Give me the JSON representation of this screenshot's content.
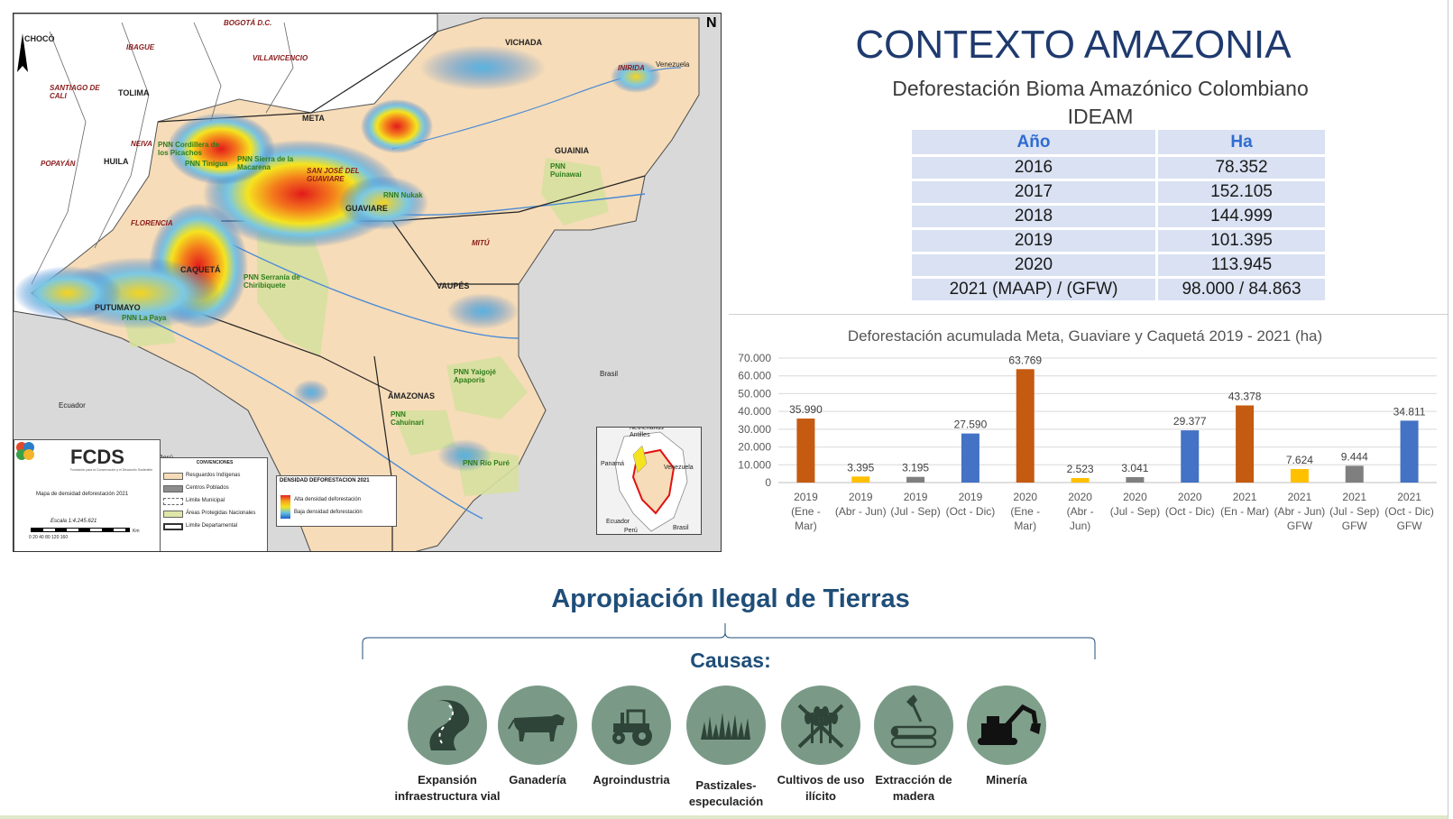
{
  "map": {
    "departments": [
      "META",
      "GUAVIARE",
      "CAQUETÁ",
      "PUTUMAYO",
      "VAUPÉS",
      "AMAZONAS",
      "GUAINIA",
      "VICHADA",
      "INIRIDA",
      "MITÚ",
      "TOLIMA",
      "HUILA",
      "NEIVA",
      "CHOCÓ",
      "IBAGUE",
      "POPAYÁN",
      "SANTIAGO DE CALI",
      "BOGOTÁ D.C.",
      "VILLAVICENCIO",
      "SAN JOSÉ DEL GUAVIARE",
      "FLORENCIA"
    ],
    "protected_areas": [
      "PNN Cordillera de los Picachos",
      "PNN Tinigua",
      "PNN Sierra de la Macarena",
      "RNN Nukak",
      "PNN Puinawai",
      "PNN Serranía de Chiribiquete",
      "PNN La Paya",
      "PNN Yaigojé Apaporis",
      "PNN Cahuinarí",
      "PNN Río Puré"
    ],
    "countries": [
      "Ecuador",
      "Perú",
      "Brasil",
      "Venezuela"
    ],
    "north_label": "N",
    "logo_text": "FCDS",
    "logo_subtitle": "Fundación para la Conservación y el Desarrollo Sostenible",
    "map_title": "Mapa de densidad deforestación 2021",
    "scale_text": "Escala 1:4.245.621",
    "scale_ticks": "0   20   40        80        120       160",
    "scale_unit": "Km",
    "conventions_title": "CONVENCIONES",
    "conventions": [
      {
        "label": "Resguardos Indígenas",
        "color": "#f6dcb8"
      },
      {
        "label": "Centros Poblados",
        "color": "#8c8c8c"
      },
      {
        "label": "Limite Municipal",
        "color": "#ffffff"
      },
      {
        "label": "Áreas Protegidas Nacionales",
        "color": "#dfe6a8"
      },
      {
        "label": "Limite Departamental",
        "color": "#ffffff"
      }
    ],
    "density_title": "DENSIDAD DEFORESTACION 2021",
    "density_high": "Alta densidad deforestación",
    "density_low": "Baja densidad deforestación",
    "inset_labels": [
      "Netherlands Antilles",
      "Panamá",
      "Venezuela",
      "Ecuador",
      "Perú",
      "Brasil"
    ]
  },
  "header": {
    "title": "CONTEXTO AMAZONIA",
    "subtitle": "Deforestación Bioma Amazónico Colombiano",
    "source": "IDEAM"
  },
  "table": {
    "headers": [
      "Año",
      "Ha"
    ],
    "rows": [
      [
        "2016",
        "78.352"
      ],
      [
        "2017",
        "152.105"
      ],
      [
        "2018",
        "144.999"
      ],
      [
        "2019",
        "101.395"
      ],
      [
        "2020",
        "113.945"
      ],
      [
        "2021 (MAAP) / (GFW)",
        "98.000 / 84.863"
      ]
    ]
  },
  "chart_data": {
    "type": "bar",
    "title": "Deforestación acumulada Meta, Guaviare y Caquetá 2019 - 2021 (ha)",
    "xlabel": "",
    "ylabel": "",
    "ylim": [
      0,
      70000
    ],
    "yticks": [
      "0",
      "10.000",
      "20.000",
      "30.000",
      "40.000",
      "50.000",
      "60.000",
      "70.000"
    ],
    "categories": [
      [
        "2019",
        "(Ene -",
        "Mar)"
      ],
      [
        "2019",
        "(Abr - Jun)"
      ],
      [
        "2019",
        "(Jul - Sep)"
      ],
      [
        "2019",
        "(Oct - Dic)"
      ],
      [
        "2020",
        "(Ene -",
        "Mar)"
      ],
      [
        "2020",
        "(Abr -",
        "Jun)"
      ],
      [
        "2020",
        "(Jul - Sep)"
      ],
      [
        "2020",
        "(Oct - Dic)"
      ],
      [
        "2021",
        "(En - Mar)"
      ],
      [
        "2021",
        "(Abr - Jun)",
        "GFW"
      ],
      [
        "2021",
        "(Jul - Sep)",
        "GFW"
      ],
      [
        "2021",
        "(Oct - Dic)",
        "GFW"
      ]
    ],
    "values": [
      35990,
      3395,
      3195,
      27590,
      63769,
      2523,
      3041,
      29377,
      43378,
      7624,
      9444,
      34811
    ],
    "value_labels": [
      "35.990",
      "3.395",
      "3.195",
      "27.590",
      "63.769",
      "2.523",
      "3.041",
      "29.377",
      "43.378",
      "7.624",
      "9.444",
      "34.811"
    ],
    "bar_colors": [
      "#c55a11",
      "#ffc000",
      "#7f7f7f",
      "#4472c4",
      "#c55a11",
      "#ffc000",
      "#7f7f7f",
      "#4472c4",
      "#c55a11",
      "#ffc000",
      "#7f7f7f",
      "#4472c4"
    ],
    "grid": true,
    "legend": "none"
  },
  "bottom": {
    "title": "Apropiación Ilegal de Tierras",
    "causes_label": "Causas:",
    "causes": [
      {
        "icon": "road-icon",
        "label": [
          "Expansión",
          "infraestructura vial"
        ]
      },
      {
        "icon": "cow-icon",
        "label": [
          "Ganadería"
        ]
      },
      {
        "icon": "tractor-icon",
        "label": [
          "Agroindustria"
        ]
      },
      {
        "icon": "grass-icon",
        "label": [
          "Pastizales-",
          "especulación"
        ]
      },
      {
        "icon": "crossed-crops-icon",
        "label": [
          "Cultivos de uso",
          "ilícito"
        ]
      },
      {
        "icon": "axe-log-icon",
        "label": [
          "Extracción de",
          "madera"
        ]
      },
      {
        "icon": "excavator-icon",
        "label": [
          "Minería"
        ]
      }
    ]
  },
  "colors": {
    "title_blue": "#1f3a6e",
    "section_blue": "#1f4e79",
    "table_fill": "#d9e1f2",
    "icon_circle": "#7a9a87",
    "icon_dark": "#2e4438"
  }
}
